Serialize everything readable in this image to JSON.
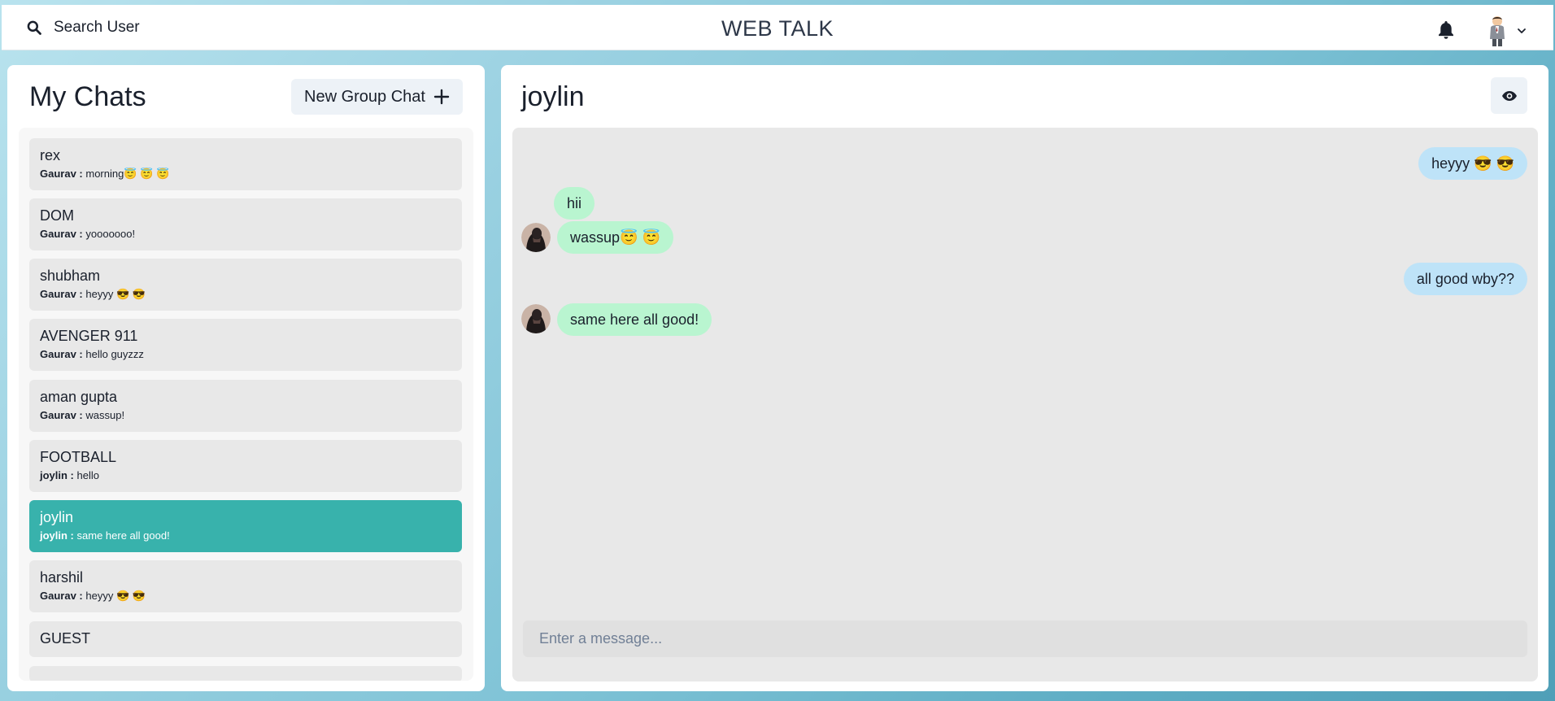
{
  "header": {
    "search_label": "Search User",
    "brand": "WEB TALK"
  },
  "left": {
    "title": "My Chats",
    "new_group_label": "New Group Chat",
    "chats": [
      {
        "name": "rex",
        "sender": "Gaurav :",
        "preview": "morning😇 😇 😇"
      },
      {
        "name": "DOM",
        "sender": "Gaurav :",
        "preview": "yooooooo!"
      },
      {
        "name": "shubham",
        "sender": "Gaurav :",
        "preview": "heyyy 😎 😎"
      },
      {
        "name": "AVENGER 911",
        "sender": "Gaurav :",
        "preview": "hello guyzzz"
      },
      {
        "name": "aman gupta",
        "sender": "Gaurav :",
        "preview": "wassup!"
      },
      {
        "name": "FOOTBALL",
        "sender": "joylin :",
        "preview": "hello"
      },
      {
        "name": "joylin",
        "sender": "joylin :",
        "preview": "same here all good!",
        "active": true
      },
      {
        "name": "harshil",
        "sender": "Gaurav :",
        "preview": "heyyy 😎 😎"
      },
      {
        "name": "GUEST"
      }
    ]
  },
  "right": {
    "title": "joylin",
    "messages": [
      {
        "text": "heyyy 😎 😎",
        "side": "sent"
      },
      {
        "text": "hii",
        "side": "recv"
      },
      {
        "text": "wassup😇 😇",
        "side": "recv"
      },
      {
        "text": "all good wby??",
        "side": "sent"
      },
      {
        "text": "same here all good!",
        "side": "recv"
      }
    ],
    "input_placeholder": "Enter a message..."
  },
  "colors": {
    "active_chat": "#38b2ac",
    "sent_bubble": "#bee3f8",
    "recv_bubble": "#b9f5d0"
  }
}
